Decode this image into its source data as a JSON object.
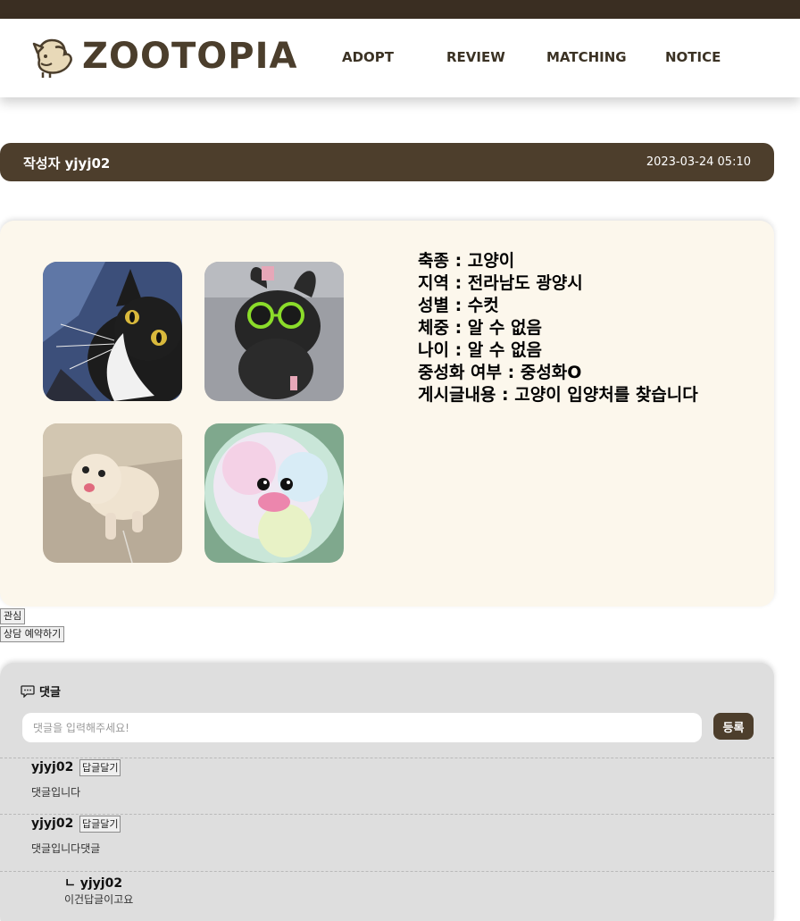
{
  "header": {
    "logo_text": "ZOOTOPIA",
    "nav": [
      {
        "label": "ADOPT"
      },
      {
        "label": "REVIEW"
      },
      {
        "label": "MATCHING"
      },
      {
        "label": "NOTICE"
      }
    ]
  },
  "post": {
    "author": "작성자 yjyj02",
    "date": "2023-03-24 05:10",
    "photos": [
      {
        "subject": "black-and-white cat"
      },
      {
        "subject": "dark plush toy with green glasses"
      },
      {
        "subject": "white fluffy dog"
      },
      {
        "subject": "rainbow fluffy plush with pink beak"
      }
    ],
    "info": [
      "축종 : 고양이",
      "지역 : 전라남도 광양시",
      "성별 : 수컷",
      "체중 : 알 수 없음",
      "나이 : 알 수 없음",
      "중성화 여부 : 중성화O",
      "게시글내용 : 고양이 입양처를 찾습니다"
    ]
  },
  "actions": {
    "interest_label": "관심",
    "reserve_label": "상담 예약하기"
  },
  "comments": {
    "title": "댓글",
    "input_placeholder": "댓글을 입력해주세요!",
    "submit_label": "등록",
    "items": [
      {
        "user": "yjyj02",
        "reply_label": "답글달기",
        "text": "댓글입니다"
      },
      {
        "user": "yjyj02",
        "reply_label": "답글달기",
        "text": "댓글입니다댓글"
      }
    ],
    "replies": [
      {
        "user": "ㄴ yjyj02",
        "text": "이건답글이고요"
      }
    ]
  },
  "colors": {
    "brand_dark": "#4d3e2c",
    "topbar": "#3a2e22",
    "card_bg": "#fcf7ec",
    "comments_bg": "#dedede"
  }
}
